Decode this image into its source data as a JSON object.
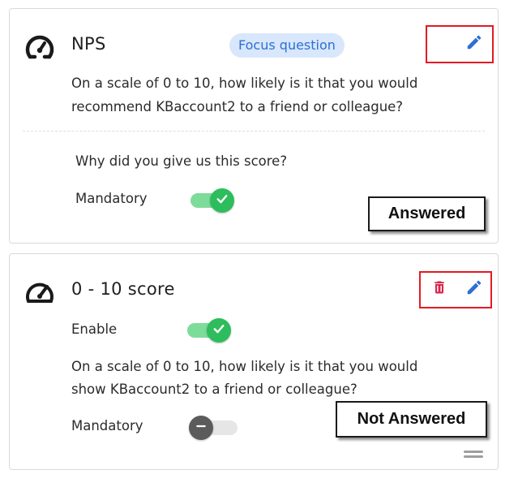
{
  "card1": {
    "title": "NPS",
    "badge": "Focus question",
    "question_line1": "On a scale of 0 to 10, how likely is it that you would",
    "question_line2": "recommend KBaccount2 to a friend or colleague?",
    "followup": "Why did you give us this score?",
    "mandatory_label": "Mandatory",
    "mandatory_on": true,
    "status": "Answered"
  },
  "card2": {
    "title": "0 - 10 score",
    "enable_label": "Enable",
    "enable_on": true,
    "question_line1": "On a scale of 0 to 10, how likely is it that you would",
    "question_line2": "show KBaccount2 to a friend or colleague?",
    "mandatory_label": "Mandatory",
    "mandatory_on": false,
    "status": "Not Answered"
  },
  "icons": {
    "nps": "gauge-icon",
    "score": "speedometer-icon",
    "edit": "pencil-icon",
    "delete": "trash-icon",
    "drag": "drag-handle-icon",
    "check": "check-icon",
    "minus": "minus-icon"
  },
  "colors": {
    "accent_blue": "#2d6fd6",
    "badge_bg": "#d8e7fb",
    "toggle_on": "#2ebd5d",
    "toggle_track_on": "#7ddc9a",
    "toggle_off": "#5b5b5b",
    "delete_red": "#d6264a",
    "highlight_red": "#e21b23"
  }
}
